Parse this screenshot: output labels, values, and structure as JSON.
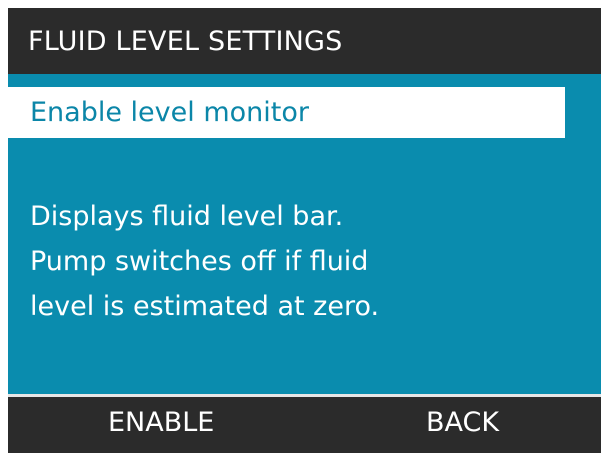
{
  "header": {
    "title": "FLUID LEVEL SETTINGS"
  },
  "menu": {
    "selected_item": "Enable level monitor"
  },
  "description": {
    "lines": [
      "Displays fluid level bar.",
      "Pump switches off if fluid",
      "level is estimated at zero."
    ]
  },
  "softkeys": {
    "left": "ENABLE",
    "right": "BACK"
  },
  "colors": {
    "screen_background": "#0a8cae",
    "bar_background": "#2b2b2b",
    "selection_background": "#ffffff",
    "selection_text": "#0b86a8",
    "text": "#ffffff"
  }
}
